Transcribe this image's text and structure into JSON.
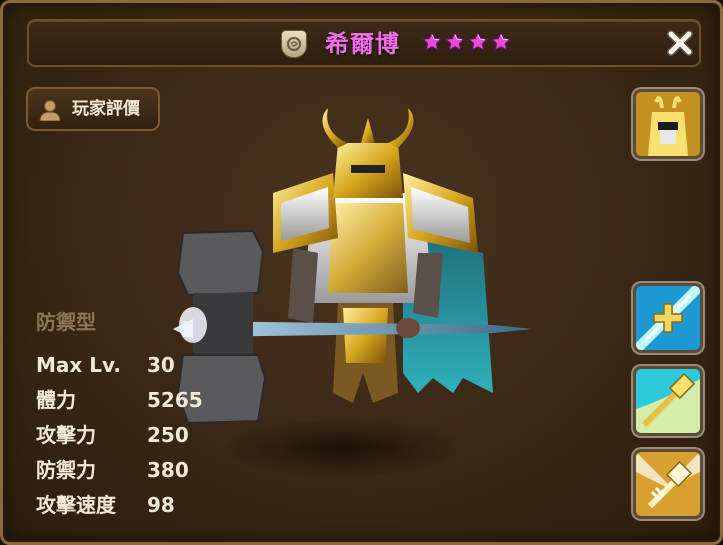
{
  "header": {
    "monster_name": "希爾博",
    "star_count": 4,
    "star_color": "#e84ad8",
    "badge_icon": "element-badge-icon",
    "close_icon": "close-x-icon"
  },
  "rating_button": {
    "label": "玩家評價",
    "icon": "person-icon"
  },
  "monster": {
    "type": "防禦型",
    "stats": [
      {
        "label": "Max Lv.",
        "value": "30"
      },
      {
        "label": "體力",
        "value": "5265"
      },
      {
        "label": "攻擊力",
        "value": "250"
      },
      {
        "label": "防禦力",
        "value": "380"
      },
      {
        "label": "攻擊速度",
        "value": "98"
      }
    ]
  },
  "side_buttons": [
    "monster-portrait",
    "skill-1",
    "skill-2",
    "skill-3"
  ],
  "colors": {
    "panel_bg": "#3a2714",
    "border": "#8a6a3c",
    "name": "#f06ee8",
    "stat_text": "#f2ead6",
    "type_text": "#8c7558",
    "armor_gold": "#d8a820",
    "cape": "#2a9aa8"
  }
}
